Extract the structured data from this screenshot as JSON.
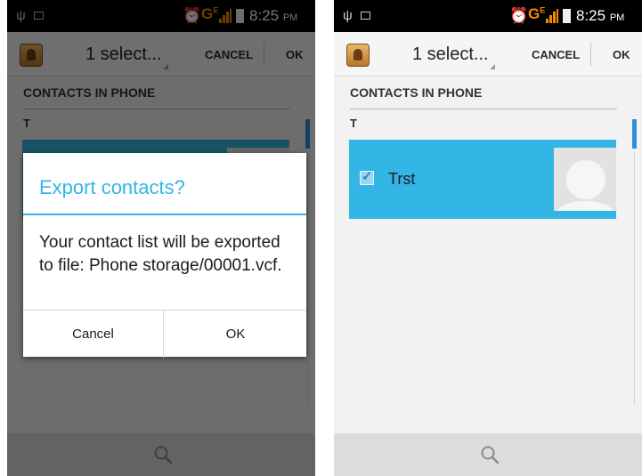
{
  "status_bar": {
    "network": "G",
    "network_sup": "E",
    "time": "8:25",
    "ampm": "PM",
    "accent_color": "#f08c00",
    "icons": [
      "usb-icon",
      "image-icon",
      "alarm-icon",
      "signal-icon",
      "battery-icon"
    ]
  },
  "action_bar": {
    "selected_label": "1 select...",
    "cancel_label": "CANCEL",
    "ok_label": "OK",
    "app_icon": "contacts-icon"
  },
  "list": {
    "section_header": "CONTACTS IN PHONE",
    "letter_header": "T",
    "contacts": [
      {
        "name": "Trst",
        "checked": true,
        "highlight_color": "#33b5e5"
      }
    ]
  },
  "bottom_bar": {
    "icon": "search-icon"
  },
  "dialog": {
    "title": "Export contacts?",
    "message": "Your contact list will be exported to file: Phone storage/00001.vcf.",
    "cancel_label": "Cancel",
    "ok_label": "OK",
    "accent_color": "#33b5e5"
  }
}
